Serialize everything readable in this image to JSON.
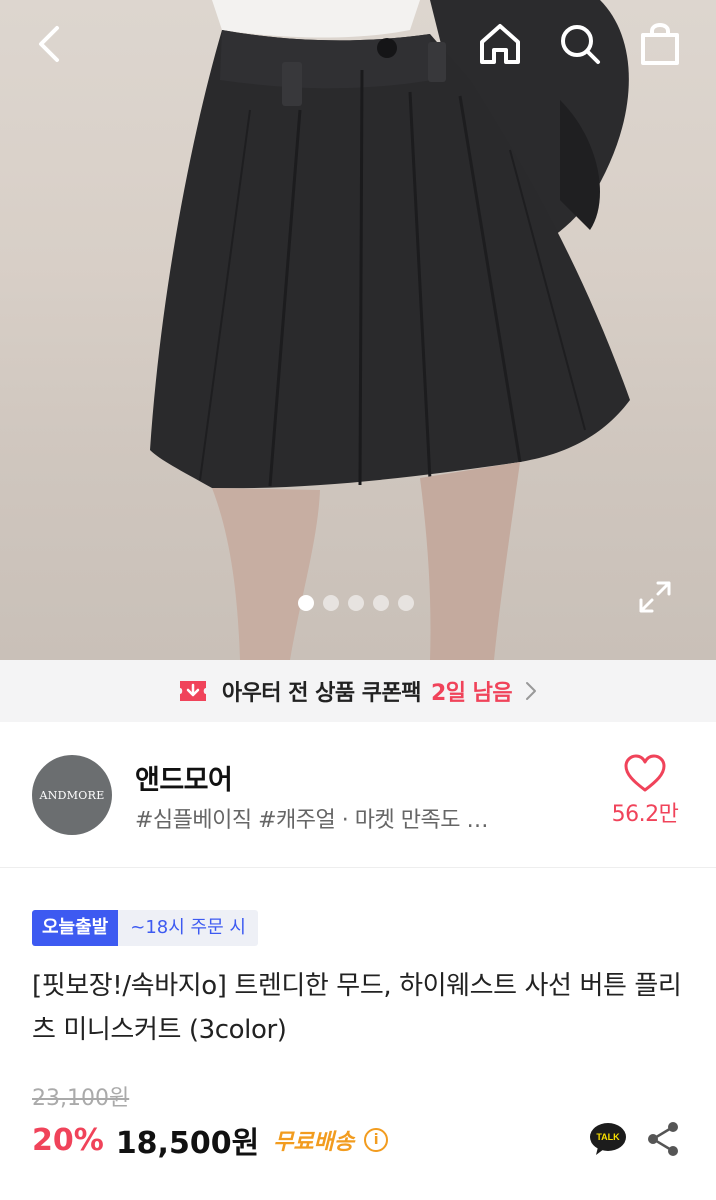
{
  "header": {
    "back_icon": "chevron-left-icon",
    "home_icon": "home-icon",
    "search_icon": "search-icon",
    "bag_icon": "shopping-bag-icon"
  },
  "gallery": {
    "total_images": 5,
    "active_index": 0,
    "expand_icon": "expand-icon"
  },
  "coupon_banner": {
    "text": "아우터 전 상품 쿠폰팩",
    "remaining": "2일 남음",
    "accent_color": "#f0435a"
  },
  "shop": {
    "logo_text": "ANDMORE",
    "name": "앤드모어",
    "tags": "#심플베이직 #캐주얼 · 마켓 만족도 …",
    "like_count": "56.2만",
    "like_icon": "heart-outline-icon"
  },
  "product": {
    "badge_primary": "오늘출발",
    "badge_secondary": "~18시 주문 시",
    "title": "[핏보장!/속바지o] 트렌디한 무드, 하이웨스트 사선 버튼 플리츠 미니스커트 (3color)",
    "original_price": "23,100원",
    "discount": "20%",
    "price": "18,500원",
    "shipping": "무료배송",
    "talk_label": "TALK"
  },
  "colors": {
    "accent_red": "#f0435a",
    "badge_blue": "#3d5af1",
    "shipping_orange": "#f29c1f"
  }
}
